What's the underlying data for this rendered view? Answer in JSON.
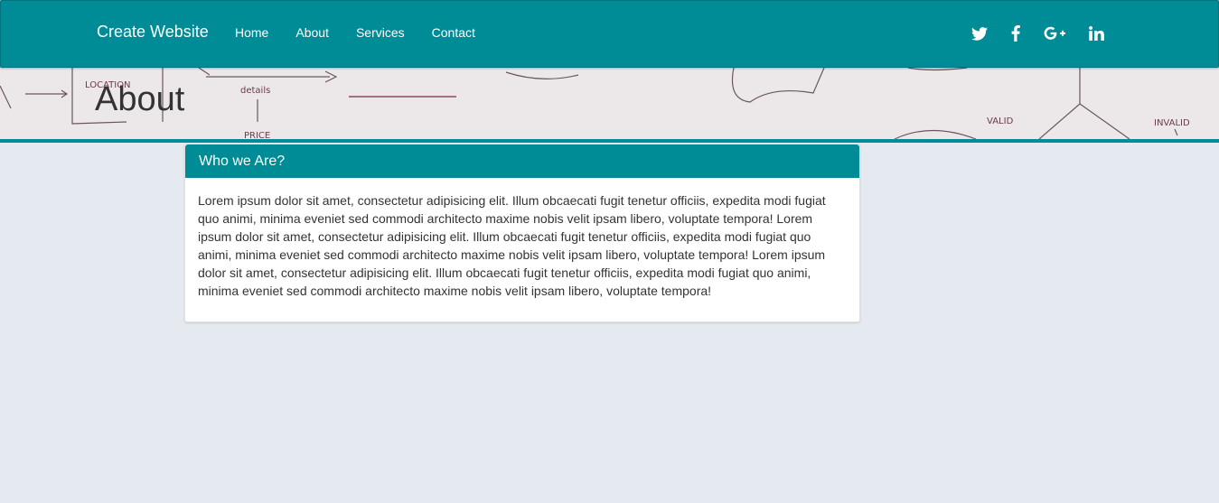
{
  "navbar": {
    "brand": "Create Website",
    "links": [
      "Home",
      "About",
      "Services",
      "Contact"
    ],
    "social": [
      "twitter-icon",
      "facebook-icon",
      "google-plus-icon",
      "linkedin-icon"
    ],
    "color": "#008c96"
  },
  "hero": {
    "title": "About",
    "sketch_text": [
      "LOCATION",
      "details",
      "VALID",
      "INVALID",
      "PRICE"
    ]
  },
  "panel": {
    "heading": "Who we Are?",
    "body": "Lorem ipsum dolor sit amet, consectetur adipisicing elit. Illum obcaecati fugit tenetur officiis, expedita modi fugiat quo animi, minima eveniet sed commodi architecto maxime nobis velit ipsam libero, voluptate tempora! Lorem ipsum dolor sit amet, consectetur adipisicing elit. Illum obcaecati fugit tenetur officiis, expedita modi fugiat quo animi, minima eveniet sed commodi architecto maxime nobis velit ipsam libero, voluptate tempora! Lorem ipsum dolor sit amet, consectetur adipisicing elit. Illum obcaecati fugit tenetur officiis, expedita modi fugiat quo animi, minima eveniet sed commodi architecto maxime nobis velit ipsam libero, voluptate tempora!"
  },
  "colors": {
    "accent": "#008c96",
    "background": "#e5e9f0"
  }
}
